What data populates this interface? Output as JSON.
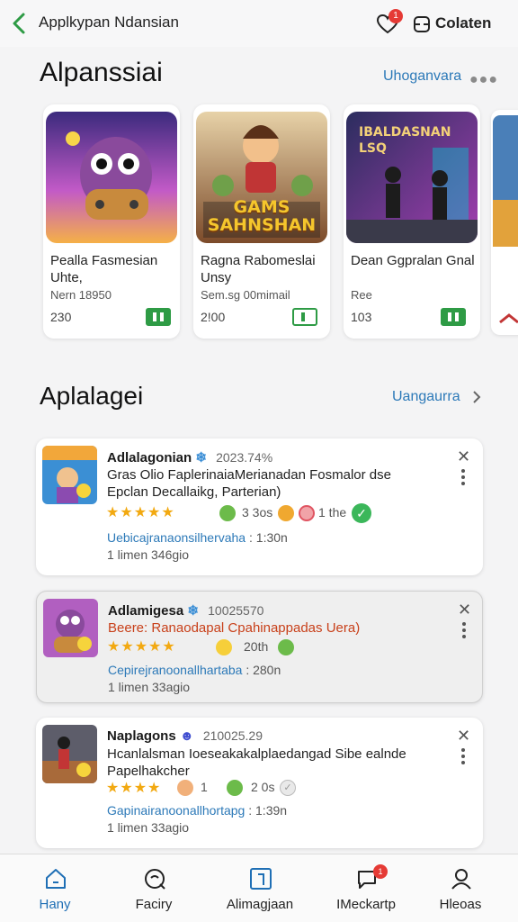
{
  "header": {
    "title": "Applkypan Ndansian",
    "heart_badge": "1",
    "collection_label": "Colaten"
  },
  "section1": {
    "title": "Alpanssiai",
    "link": "Uhoganvara",
    "cards": [
      {
        "name": "Pealla Fasmesian Uhte,",
        "sub": "Nern 18950",
        "num": "230",
        "thumb_text": ""
      },
      {
        "name": "Ragna Rabomeslai Unsy",
        "sub": "Sem.sg 00mimail",
        "num": "2!00",
        "thumb_text": "GAMS SAHNSHAN"
      },
      {
        "name": "Dean Ggpralan Gnal",
        "sub": "Ree",
        "num": "103",
        "thumb_text": "IBALDASNAN LSQ"
      }
    ]
  },
  "section2": {
    "title": "Aplalagei",
    "link": "Uangaurra",
    "reviews": [
      {
        "name": "Adlalagonian",
        "version": "2023.74%",
        "body": "Gras Olio FaplerinaiaMerianadan Fosmalor dse Epclan Decallaikg, Parterian)",
        "stars": "★★★★★",
        "meta1": "3 3os",
        "meta2": "1 the",
        "link": "Uebicajranaonsilhervaha",
        "link_time": ": 1:30n",
        "time": "1 limen 346gio"
      },
      {
        "name": "Adlamigesa",
        "version": "10025570",
        "body": "Beere: Ranaodapal Cpahinappadas Uera)",
        "stars": "★★★★★",
        "meta1": "20th",
        "meta2": "",
        "link": "Cepirejranoonallhartaba",
        "link_time": ": 280n",
        "time": "1 limen 33agio"
      },
      {
        "name": "Naplagons",
        "version": "210025.29",
        "body": "Hcanlalsman Ioeseakakalplaedangad Sibe ealnde Papelhakcher",
        "stars": "★★★★",
        "meta1": "1",
        "meta2": "2 0s",
        "link": "Gapinairanoonallhortapg",
        "link_time": ": 1:39n",
        "time": "1 limen 33agio"
      }
    ]
  },
  "bottom_nav": [
    {
      "label": "Hany",
      "icon": "home-icon"
    },
    {
      "label": "Faciry",
      "icon": "search-icon"
    },
    {
      "label": "Alimagjaan",
      "icon": "apps-icon"
    },
    {
      "label": "IMeckartp",
      "icon": "chat-icon",
      "badge": "1"
    },
    {
      "label": "Hleoas",
      "icon": "profile-icon"
    }
  ],
  "colors": {
    "accent": "#2c79b8",
    "green": "#2e9b45",
    "star": "#f2a911",
    "badge": "#e53a35"
  }
}
